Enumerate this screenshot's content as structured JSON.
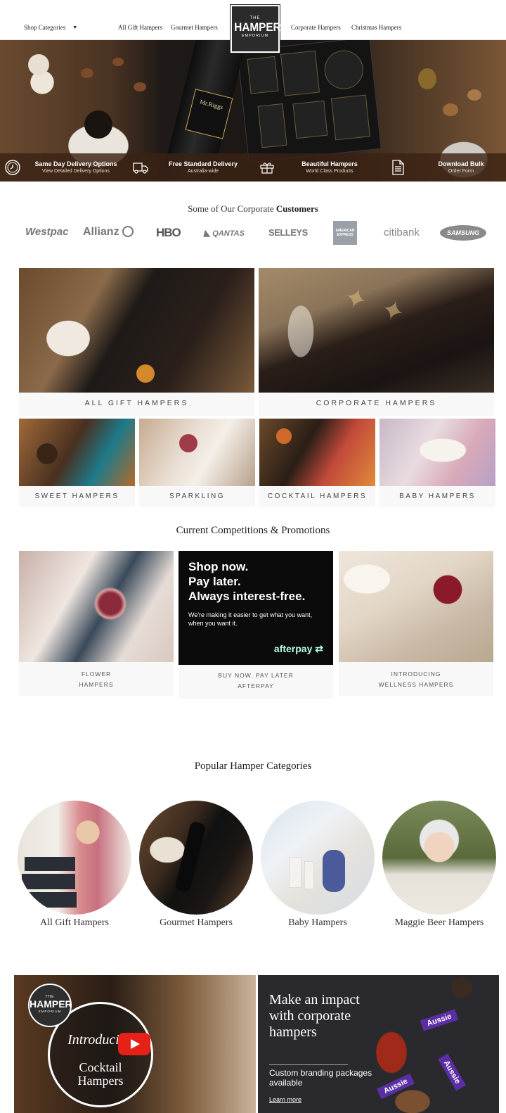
{
  "header": {
    "shop_categories": "Shop Categories",
    "nav_left": [
      "All Gift Hampers",
      "Gourmet Hampers"
    ],
    "nav_right": [
      "Corporate Hampers",
      "Christmas Hampers"
    ],
    "logo": {
      "line1": "THE",
      "line2": "HAMPER",
      "line3": "EMPORIUM"
    }
  },
  "hero": {
    "bottle_label": "Mr.Riggs",
    "features": [
      {
        "title": "Same Day Delivery Options",
        "sub": "View Detailed Delivery Options",
        "icon": "clock-icon"
      },
      {
        "title": "Free Standard Delivery",
        "sub": "Australia-wide",
        "icon": "truck-icon"
      },
      {
        "title": "Beautiful Hampers",
        "sub": "World Class Products",
        "icon": "gift-box-icon"
      },
      {
        "title": "Download Bulk",
        "sub": "Order Form",
        "icon": "document-icon"
      }
    ]
  },
  "customers": {
    "title_plain": "Some of Our Corporate",
    "title_bold": "Customers",
    "logos": [
      "Westpac",
      "Allianz",
      "HBO",
      "QANTAS",
      "SELLEYS",
      "AMERICAN EXPRESS",
      "citibank",
      "SAMSUNG"
    ]
  },
  "tiles": {
    "large": [
      "ALL GIFT HAMPERS",
      "CORPORATE HAMPERS"
    ],
    "small": [
      "SWEET HAMPERS",
      "SPARKLING",
      "COCKTAIL HAMPERS",
      "BABY HAMPERS"
    ]
  },
  "promotions": {
    "title": "Current Competitions & Promotions",
    "afterpay": {
      "headline": [
        "Shop now.",
        "Pay later.",
        "Always interest-free."
      ],
      "body": "We're making it easier to get what you want, when you want it.",
      "brand": "afterpay"
    },
    "items": [
      {
        "line1": "FLOWER",
        "line2": "HAMPERS"
      },
      {
        "line1": "BUY NOW, PAY LATER",
        "line2": "AFTERPAY"
      },
      {
        "line1": "INTRODUCING",
        "line2": "WELLNESS HAMPERS"
      }
    ]
  },
  "popular": {
    "title": "Popular Hamper Categories",
    "items": [
      "All Gift Hampers",
      "Gourmet Hampers",
      "Baby Hampers",
      "Maggie Beer Hampers"
    ]
  },
  "banners": {
    "video": {
      "intro": "Introducing",
      "line1": "Cocktail",
      "line2": "Hampers"
    },
    "corporate": {
      "headline": "Make an impact with corporate hampers",
      "sub": "Custom branding packages available",
      "link": "Learn more",
      "ribbon": "Aussie"
    }
  },
  "colors": {
    "strip": "#3a2214",
    "afterpay_mint": "#b2fce4",
    "ribbon": "#5b2ea6",
    "youtube": "#e62117"
  }
}
